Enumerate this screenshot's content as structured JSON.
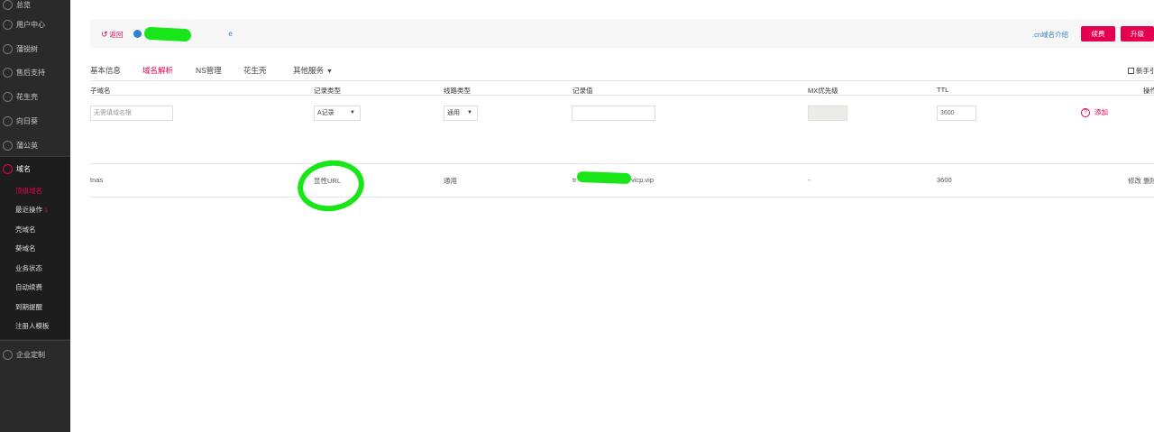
{
  "sidebar": {
    "items": [
      {
        "label": "总览",
        "icon": "grid-icon"
      },
      {
        "label": "用户中心",
        "icon": "user-icon"
      },
      {
        "label": "蒲锐树",
        "icon": "target-icon"
      },
      {
        "label": "售后支持",
        "icon": "headset-icon"
      },
      {
        "label": "花生壳",
        "icon": "peanut-icon"
      },
      {
        "label": "向日葵",
        "icon": "sunflower-icon"
      },
      {
        "label": "蒲公英",
        "icon": "dandelion-icon"
      },
      {
        "label": "域名",
        "icon": "domain-icon"
      },
      {
        "label": "企业定制",
        "icon": "diamond-icon"
      }
    ],
    "sub_items": [
      {
        "label": "顶级域名"
      },
      {
        "label": "最近操作",
        "badge": "1"
      },
      {
        "label": "壳域名"
      },
      {
        "label": "葵域名"
      },
      {
        "label": "业务状态"
      },
      {
        "label": "自动续费"
      },
      {
        "label": "到期提醒"
      },
      {
        "label": "注册人模板"
      }
    ]
  },
  "topbar": {
    "back_label": "返回",
    "domain_suffix": "e",
    "cn_link": ".cn域名介绍",
    "renew_label": "续费",
    "upgrade_label": "升级"
  },
  "tabs": {
    "basic": "基本信息",
    "dns": "域名解析",
    "ns": "NS管理",
    "hsk": "花生壳",
    "other": "其他服务",
    "guide": "新手引"
  },
  "table": {
    "headers": {
      "subdomain": "子域名",
      "record_type": "记录类型",
      "line_type": "线路类型",
      "record_value": "记录值",
      "mx": "MX优先级",
      "ttl": "TTL",
      "action": "操作"
    },
    "form": {
      "subdomain_placeholder": "无需填域名根",
      "record_type": "A记录",
      "line_type": "通用",
      "ttl": "3600",
      "add_label": "添加"
    },
    "rows": [
      {
        "subdomain": "tnas",
        "record_type": "显性URL",
        "line_type": "通用",
        "value_prefix": "tr",
        "value_suffix": "vicp.vip",
        "mx": "-",
        "ttl": "3600",
        "edit": "修改",
        "delete": "删除"
      }
    ]
  },
  "colors": {
    "accent": "#e4004f",
    "sidebar_bg": "#2a2a2a",
    "annotation_green": "#19e619",
    "link_blue": "#3a7cc7"
  }
}
